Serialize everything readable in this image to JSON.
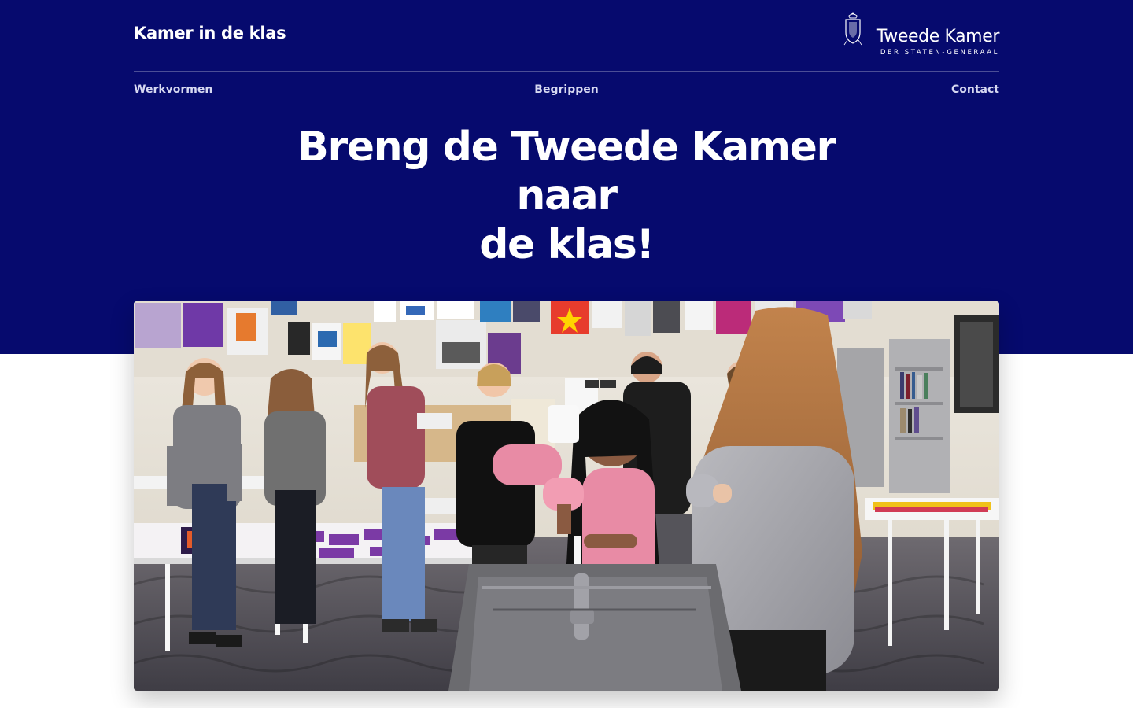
{
  "header": {
    "site_title": "Kamer in de klas",
    "logo": {
      "icon": "royal-crest-icon",
      "name": "Tweede Kamer",
      "subtitle": "DER STATEN-GENERAAL"
    }
  },
  "nav": {
    "items": [
      {
        "label": "Werkvormen"
      },
      {
        "label": "Begrippen"
      },
      {
        "label": "Contact"
      }
    ]
  },
  "hero": {
    "headline_line1": "Breng de Tweede Kamer naar",
    "headline_line2": "de klas!"
  },
  "image": {
    "icon": "classroom-voting-photo"
  },
  "colors": {
    "hero_background": "#060a6e",
    "nav_text": "#d6d8f1",
    "page_background": "#ffffff",
    "text_on_hero": "#ffffff"
  }
}
